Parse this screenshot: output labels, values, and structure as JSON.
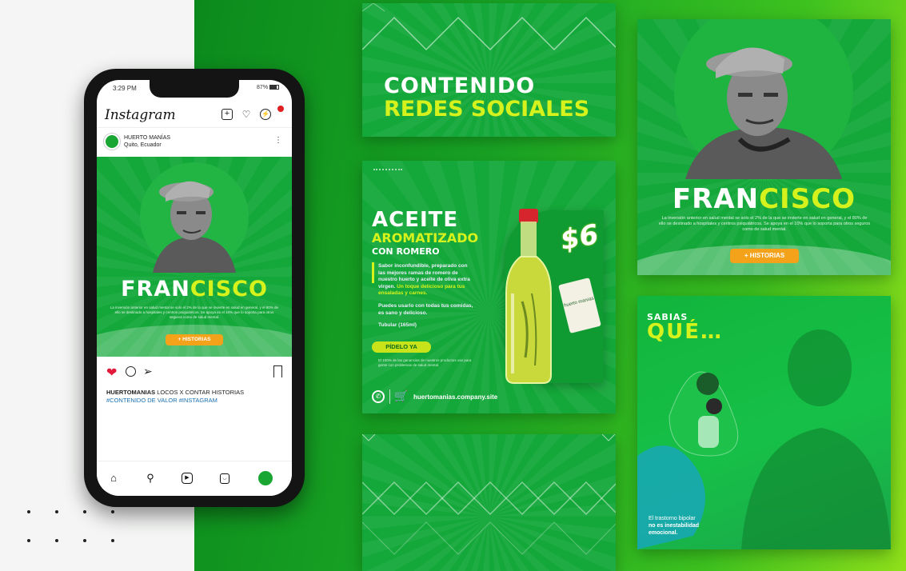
{
  "phone": {
    "time": "3:29 PM",
    "battery": "87%",
    "app_logo": "Instagram",
    "icons": [
      "add-icon",
      "heart-icon",
      "messenger-icon"
    ],
    "account_name": "HUERTO MANÍAS",
    "account_location": "Quito, Ecuador",
    "post": {
      "name_white": "FRAN",
      "name_lime": "CISCO",
      "body": "La inversión anterior en salud mental se solo el 2% de la que se invierte en salud en general, y el 80% de ello se destinado a hospitales y centros psiquiátricos. Se apoya en el 10% que lo soporta para otros seguros como de salud mental.",
      "button": "+ HISTORIAS"
    },
    "caption_user": "HUERTOMANIAS",
    "caption_text": "LOCOS X CONTAR HISTORIAS",
    "caption_hashtags": "#CONTENIDO DE VALOR #INSTAGRAM",
    "tabs": [
      "home-icon",
      "search-icon",
      "reels-icon",
      "shop-icon",
      "profile-icon"
    ]
  },
  "card_title": {
    "line1": "CONTENIDO",
    "line2": "REDES SOCIALES"
  },
  "card_oil": {
    "line1": "ACEITE",
    "line2": "AROMATIZADO",
    "line3": "CON ROMERO",
    "desc1": "Sabor inconfundible, preparado con las mejores ramas de romero de nuestro huerto y aceite de oliva extra virgen.",
    "desc1_highlight": "Un toque delicioso para tus ensaladas y carnes.",
    "desc2": "Puedes usarlo con todas tus comidas, es sano y delicioso.",
    "size": "Tubular (165ml)",
    "cta": "PÍDELO YA",
    "fine_print": "El 100% de las ganancias de nuestros productos van para gente con problemas de salud mental.",
    "price": "$6",
    "tag": "huerto manías",
    "footer": "huertomanias.company.site"
  },
  "card_francisco": {
    "name_white": "FRAN",
    "name_lime": "CISCO",
    "body": "La inversión anterior en salud mental se solo el 2% de la que se invierte en salud en general, y el 80% de ello se destinado a hospitales y centros psiquiátricos. Se apoya en el 10% que lo soporta para otros seguros como de salud mental.",
    "button": "+ HISTORIAS"
  },
  "card_sabias": {
    "line1": "SABIAS",
    "line2": "QUÉ…",
    "caption1": "El trastorno bipolar",
    "caption2": "no es inestabilidad",
    "caption3": "emocional."
  }
}
